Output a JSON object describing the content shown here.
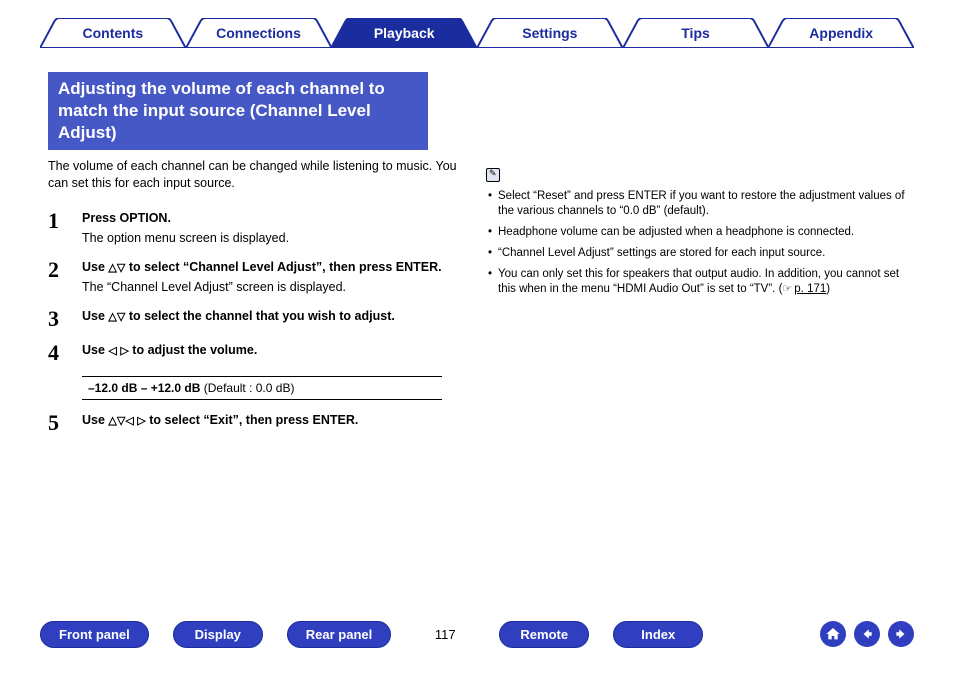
{
  "tabs": {
    "contents": "Contents",
    "connections": "Connections",
    "playback": "Playback",
    "settings": "Settings",
    "tips": "Tips",
    "appendix": "Appendix"
  },
  "heading": "Adjusting the volume of each channel to match the input source (Channel Level Adjust)",
  "lead": "The volume of each channel can be changed while listening to music. You can set this for each input source.",
  "steps": {
    "s1": {
      "num": "1",
      "title": "Press OPTION.",
      "desc": "The option menu screen is displayed."
    },
    "s2": {
      "num": "2",
      "title_pre": "Use ",
      "title_post": " to select “Channel Level Adjust”, then press ENTER.",
      "desc": "The “Channel Level Adjust” screen is displayed."
    },
    "s3": {
      "num": "3",
      "title_pre": "Use ",
      "title_post": " to select the channel that you wish to adjust."
    },
    "s4": {
      "num": "4",
      "title_pre": "Use ",
      "title_post": " to adjust the volume.",
      "param_strong": "–12.0 dB – +12.0 dB",
      "param_rest": " (Default : 0.0 dB)"
    },
    "s5": {
      "num": "5",
      "title_pre": "Use ",
      "title_post": " to select “Exit”, then press ENTER."
    }
  },
  "notes": {
    "n1": "Select “Reset” and press ENTER if you want to restore the adjustment values of the various channels to “0.0 dB” (default).",
    "n2": "Headphone volume can be adjusted when a headphone is connected.",
    "n3": "“Channel Level Adjust” settings are stored for each input source.",
    "n4_pre": "You can only set this for speakers that output audio. In addition, you cannot set this when in the menu “HDMI Audio Out” is set to “TV”.  (",
    "n4_link": "p. 171",
    "n4_post": ")"
  },
  "bottom": {
    "front_panel": "Front panel",
    "display": "Display",
    "rear_panel": "Rear panel",
    "page": "117",
    "remote": "Remote",
    "index": "Index"
  }
}
